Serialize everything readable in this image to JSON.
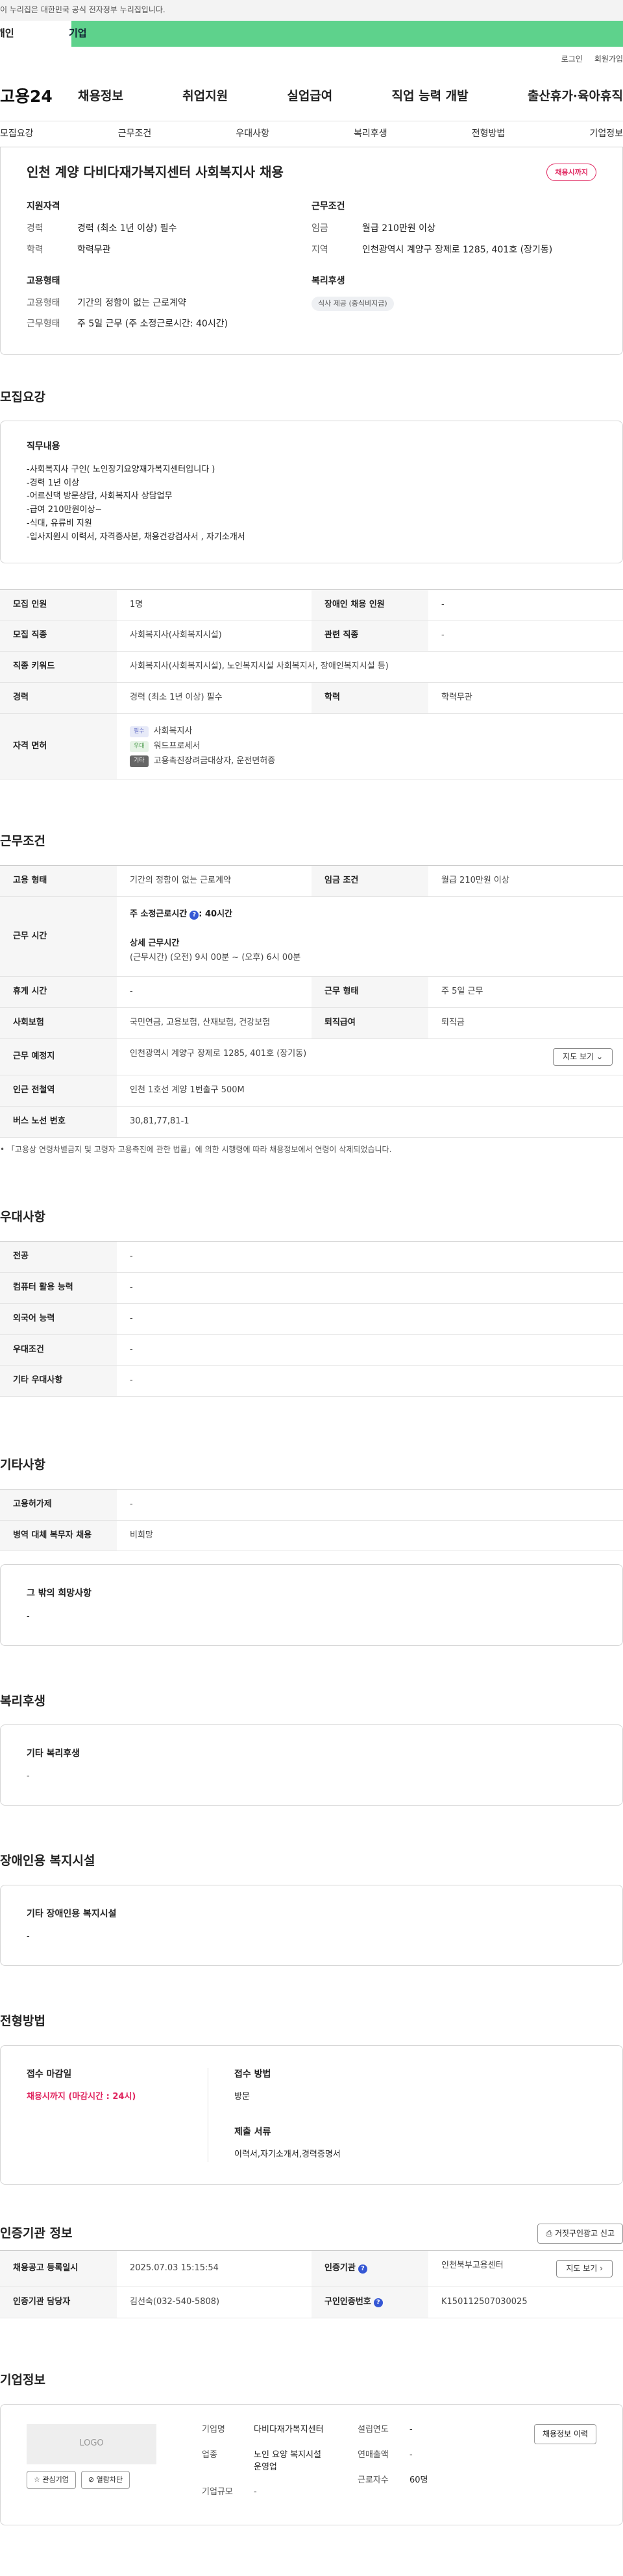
{
  "gov_notice": "이 누리집은 대한민국 공식 전자정부 누리집입니다.",
  "mode": {
    "individual": "개인",
    "corporate": "기업"
  },
  "util": {
    "login": "로그인",
    "signup": "회원가입"
  },
  "logo": "고용24",
  "gnb": [
    "채용정보",
    "취업지원",
    "실업급여",
    "직업 능력 개발",
    "출산휴가·육아휴직"
  ],
  "subnav": [
    "모집요강",
    "근무조건",
    "우대사항",
    "복리후생",
    "전형방법",
    "기업정보"
  ],
  "summary": {
    "title": "인천 계양 다비다재가복지센터 사회복지사 채용",
    "status": "채용시까지",
    "qual": {
      "h": "지원자격",
      "exp_k": "경력",
      "exp_v": "경력 (최소 1년 이상) 필수",
      "edu_k": "학력",
      "edu_v": "학력무관"
    },
    "cond": {
      "h": "근무조건",
      "pay_k": "임금",
      "pay_v": "월급 210만원 이상",
      "loc_k": "지역",
      "loc_v": "인천광역시 계양구 장제로 1285, 401호 (장기동)"
    },
    "emp": {
      "h": "고용형태",
      "type_k": "고용형태",
      "type_v": "기간의 정함이 없는 근로계약",
      "work_k": "근무형태",
      "work_v": "주 5일 근무 (주 소정근로시간: 40시간)"
    },
    "welfare": {
      "h": "복리후생",
      "chip": "식사 제공 (중식비지급)"
    }
  },
  "recruit": {
    "title": "모집요강",
    "desc_h": "직무내용",
    "desc": "-사회복지사 구인( 노인장기요양재가복지센터입니다 )\n-경력 1년 이상\n-어르신댁 방문상담, 사회복지사 상담업무\n-급여 210만원이상~\n-식대, 유류비 지원\n-입사지원시 이력서, 자격증사본, 채용건강검사서 , 자기소개서",
    "rows": {
      "count_k": "모집 인원",
      "count_v": "1명",
      "dis_k": "장애인 채용 인원",
      "dis_v": "-",
      "job_k": "모집 직종",
      "job_v": "사회복지사(사회복지시설)",
      "rel_k": "관련 직종",
      "rel_v": "-",
      "kw_k": "직종 키워드",
      "kw_v": "사회복지사(사회복지시설), 노인복지시설 사회복지사, 장애인복지시설 등)",
      "exp_k": "경력",
      "exp_v": "경력 (최소 1년 이상) 필수",
      "edu_k": "학력",
      "edu_v": "학력무관",
      "lic_k": "자격 면허",
      "lics": [
        {
          "tag": "필수",
          "name": "사회복지사"
        },
        {
          "tag": "우대",
          "name": "워드프로세서"
        },
        {
          "tag": "기타",
          "name": "고용촉진장려금대상자, 운전면허증"
        }
      ]
    }
  },
  "cond": {
    "title": "근무조건",
    "type_k": "고용 형태",
    "type_v": "기간의 정함이 없는 근로계약",
    "pay_k": "임금 조건",
    "pay_v": "월급 210만원 이상",
    "hours_k": "근무 시간",
    "hours_l1": "주 소정근로시간",
    "hours_l1b": ": 40시간",
    "hours_l2": "상세 근무시간",
    "hours_l3": "(근무시간) (오전) 9시 00분 ~ (오후) 6시 00분",
    "rest_k": "휴게 시간",
    "rest_v": "-",
    "form_k": "근무 형태",
    "form_v": "주 5일 근무",
    "ins_k": "사회보험",
    "ins_v": "국민연금, 고용보험, 산재보험, 건강보험",
    "sev_k": "퇴직급여",
    "sev_v": "퇴직금",
    "addr_k": "근무 예정지",
    "addr_v": "인천광역시 계양구 장제로 1285, 401호 (장기동)",
    "map_btn": "지도 보기",
    "sub_k": "인근 전철역",
    "sub_v": "인천 1호선 계양 1번출구 500M",
    "bus_k": "버스 노선 번호",
    "bus_v": "30,81,77,81-1",
    "note": "「고용상 연령차별금지 및 고령자 고용촉진에 관한 법률」에 의한 시행령에 따라 채용정보에서 연령이 삭제되었습니다."
  },
  "pref": {
    "title": "우대사항",
    "rows": [
      {
        "k": "전공",
        "v": "-"
      },
      {
        "k": "컴퓨터 활용 능력",
        "v": "-"
      },
      {
        "k": "외국어 능력",
        "v": "-"
      },
      {
        "k": "우대조건",
        "v": "-"
      },
      {
        "k": "기타 우대사항",
        "v": "-"
      }
    ]
  },
  "etc": {
    "title": "기타사항",
    "rows": [
      {
        "k": "고용허가제",
        "v": "-"
      },
      {
        "k": "병역 대체 복무자 채용",
        "v": "비희망"
      }
    ],
    "box_h": "그 밖의 희망사항",
    "box_v": "-"
  },
  "welfare": {
    "title": "복리후생",
    "h": "기타 복리후생",
    "v": "-"
  },
  "disfac": {
    "title": "장애인용 복지시설",
    "h": "기타 장애인용 복지시설",
    "v": "-"
  },
  "process": {
    "title": "전형방법",
    "deadline_h": "접수 마감일",
    "deadline_v": "채용시까지 (마감시간 : 24시)",
    "method_h": "접수 방법",
    "method_v": "방문",
    "docs_h": "제출 서류",
    "docs_v": "이력서,자기소개서,경력증명서"
  },
  "agency": {
    "title": "인증기관 정보",
    "report_btn": "거짓구인광고 신고",
    "reg_k": "채용공고 등록일시",
    "reg_v": "2025.07.03 15:15:54",
    "org_k": "인증기관",
    "org_v": "인천북부고용센터",
    "map_btn": "지도 보기",
    "mgr_k": "인증기관 담당자",
    "mgr_v": "김선숙(032-540-5808)",
    "id_k": "구인인증번호",
    "id_v": "K150112507030025"
  },
  "company": {
    "title": "기업정보",
    "logo": "LOGO",
    "fav": "관심기업",
    "block": "열람차단",
    "name_k": "기업명",
    "name_v": "다비다재가복지센터",
    "est_k": "설립연도",
    "est_v": "-",
    "ind_k": "업종",
    "ind_v": "노인 요양 복지시설 운영업",
    "sales_k": "연매출액",
    "sales_v": "-",
    "emp_k": "근로자수",
    "emp_v": "60명",
    "size_k": "기업규모",
    "size_v": "-",
    "history_btn": "채용정보 이력"
  }
}
